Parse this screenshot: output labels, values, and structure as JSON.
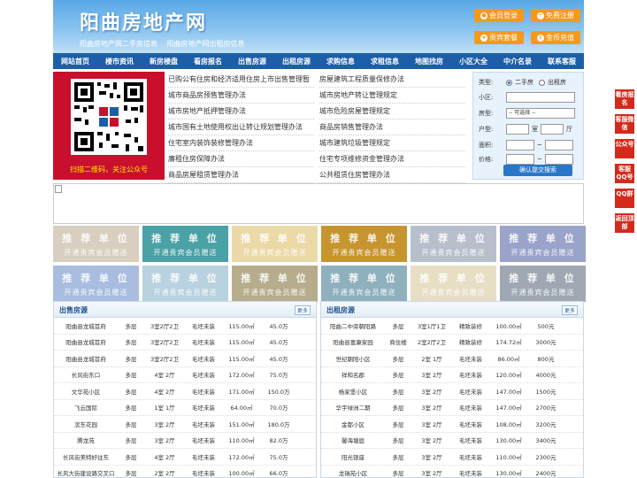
{
  "site": {
    "title": "阳曲房地产网",
    "sublinks": [
      "阳曲房地产网二手房信息",
      "阳曲房地产网出租房信息"
    ]
  },
  "header_buttons": [
    {
      "label": "会员登录",
      "icon": "user-icon"
    },
    {
      "label": "免费注册",
      "icon": "register-icon"
    },
    {
      "label": "贵宾套餐",
      "icon": "vip-icon"
    },
    {
      "label": "金币充值",
      "icon": "coin-icon"
    }
  ],
  "nav": [
    "网站首页",
    "楼市资讯",
    "新房楼盘",
    "看房报名",
    "出售房源",
    "出租房源",
    "求购信息",
    "求租信息",
    "地图找房",
    "小区大全",
    "中介名录",
    "联系客服"
  ],
  "qr": {
    "caption": "扫描二维码，关注公众号"
  },
  "links_left": [
    "已购公有住房和经济适用住房上市出售管理暂",
    "城市商品房预售管理办法",
    "城市房地产抵押管理办法",
    "城市国有土地使用权出让转让规划管理办法",
    "住宅室内装饰装修管理办法",
    "廉租住房保障办法",
    "商品房屋租赁管理办法"
  ],
  "links_right": [
    "房屋建筑工程质量保修办法",
    "城市房地产转让管理规定",
    "城市危险房屋管理规定",
    "商品房销售管理办法",
    "城市建筑垃圾管理规定",
    "住宅专项维修资金管理办法",
    "公共租赁住房管理办法"
  ],
  "search": {
    "type_label": "类型:",
    "opt_sale": "二手房",
    "opt_rent": "出租房",
    "community_label": "小区:",
    "house_label": "房型:",
    "house_select": "-- 可选择 --",
    "layout_label": "户型:",
    "room_unit": "室",
    "hall_unit": "厅",
    "area_label": "面积:",
    "price_label": "价格:",
    "tilde": "~",
    "submit": "确认提交搜索"
  },
  "tiles": [
    {
      "t1": "推 荐 单 位",
      "t2": "开通贵宾会员赠送",
      "color": "#d8cfc0"
    },
    {
      "t1": "推 荐 单 位",
      "t2": "开通贵宾会员赠送",
      "color": "#4aa1a6"
    },
    {
      "t1": "推 荐 单 位",
      "t2": "开通贵宾会员赠送",
      "color": "#ecd9a8"
    },
    {
      "t1": "推 荐 单 位",
      "t2": "开通贵宾会员赠送",
      "color": "#c7952f"
    },
    {
      "t1": "推 荐 单 位",
      "t2": "开通贵宾会员赠送",
      "color": "#b8bfcc"
    },
    {
      "t1": "推 荐 单 位",
      "t2": "开通贵宾会员赠送",
      "color": "#9aa3c9"
    },
    {
      "t1": "推 荐 单 位",
      "t2": "开通贵宾会员赠送",
      "color": "#a8bde0"
    },
    {
      "t1": "推 荐 单 位",
      "t2": "开通贵宾会员赠送",
      "color": "#b9d2df"
    },
    {
      "t1": "推 荐 单 位",
      "t2": "开通贵宾会员赠送",
      "color": "#b7ad8c"
    },
    {
      "t1": "推 荐 单 位",
      "t2": "开通贵宾会员赠送",
      "color": "#8fb0bd"
    },
    {
      "t1": "推 荐 单 位",
      "t2": "开通贵宾会员赠送",
      "color": "#e7dfc4"
    },
    {
      "t1": "推 荐 单 位",
      "t2": "开通贵宾会员赠送",
      "color": "#9fa7b3"
    }
  ],
  "sale": {
    "title": "出售房源",
    "more": "更多",
    "rows": [
      [
        "阳曲县龙城首府",
        "多层",
        "3室2厅2卫",
        "毛坯未装",
        "115.00㎡",
        "45.0万"
      ],
      [
        "阳曲县龙城首府",
        "多层",
        "3室2厅2卫",
        "毛坯未装",
        "115.00㎡",
        "45.0万"
      ],
      [
        "阳曲县龙城首府",
        "多层",
        "3室2厅2卫",
        "毛坯未装",
        "115.00㎡",
        "45.0万"
      ],
      [
        "长风街东口",
        "多层",
        "4室 2厅",
        "毛坯未装",
        "172.00㎡",
        "75.0万"
      ],
      [
        "文华苑小区",
        "多层",
        "4室 2厅",
        "毛坯未装",
        "171.00㎡",
        "150.0万"
      ],
      [
        "飞云国际",
        "多层",
        "1室 1厅",
        "毛坯未装",
        "64.00㎡",
        "70.0万"
      ],
      [
        "滨东花园",
        "多层",
        "3室 2厅",
        "毛坯未装",
        "151.00㎡",
        "180.0万"
      ],
      [
        "腾龙苑",
        "多层",
        "3室 2厅",
        "毛坯未装",
        "110.00㎡",
        "82.0万"
      ],
      [
        "长风街美特好往东",
        "多层",
        "4室 2厅",
        "毛坯未装",
        "172.00㎡",
        "75.0万"
      ],
      [
        "长风大街建设路交叉口",
        "多层",
        "2室 2厅",
        "毛坯未装",
        "100.00㎡",
        "66.0万"
      ]
    ]
  },
  "rent": {
    "title": "出租房源",
    "more": "更多",
    "rows": [
      [
        "阳曲二中旁朝阳路",
        "多层",
        "3室1厅1卫",
        "精致装修",
        "100.00㎡",
        "500元"
      ],
      [
        "阳曲县富康家园",
        "商住楼",
        "2室2厅2卫",
        "精致装修",
        "174.72㎡",
        "3000元"
      ],
      [
        "世纪朝阳小区",
        "多层",
        "2室 1厅",
        "毛坯未装",
        "86.00㎡",
        "800元"
      ],
      [
        "祥和名郡",
        "多层",
        "3室 2厅",
        "毛坯未装",
        "120.00㎡",
        "4000元"
      ],
      [
        "杨家堡小区",
        "多层",
        "3室 2厅",
        "毛坯未装",
        "147.00㎡",
        "1500元"
      ],
      [
        "华宇绿洲二期",
        "多层",
        "3室 2厅",
        "毛坯未装",
        "147.00㎡",
        "2700元"
      ],
      [
        "金都小区",
        "多层",
        "3室 2厅",
        "毛坯未装",
        "108.00㎡",
        "3200元"
      ],
      [
        "馨海塘庭",
        "多层",
        "3室 2厅",
        "毛坯未装",
        "130.00㎡",
        "3400元"
      ],
      [
        "阳光银座",
        "多层",
        "3室 2厅",
        "毛坯未装",
        "110.00㎡",
        "2300元"
      ],
      [
        "龙瑞苑小区",
        "多层",
        "3室 2厅",
        "毛坯未装",
        "130.00㎡",
        "2400元"
      ]
    ]
  },
  "sidebar": [
    "看房报名",
    "客服微信",
    "公众号",
    "客服QQ号",
    "QQ群",
    "返回顶部"
  ]
}
